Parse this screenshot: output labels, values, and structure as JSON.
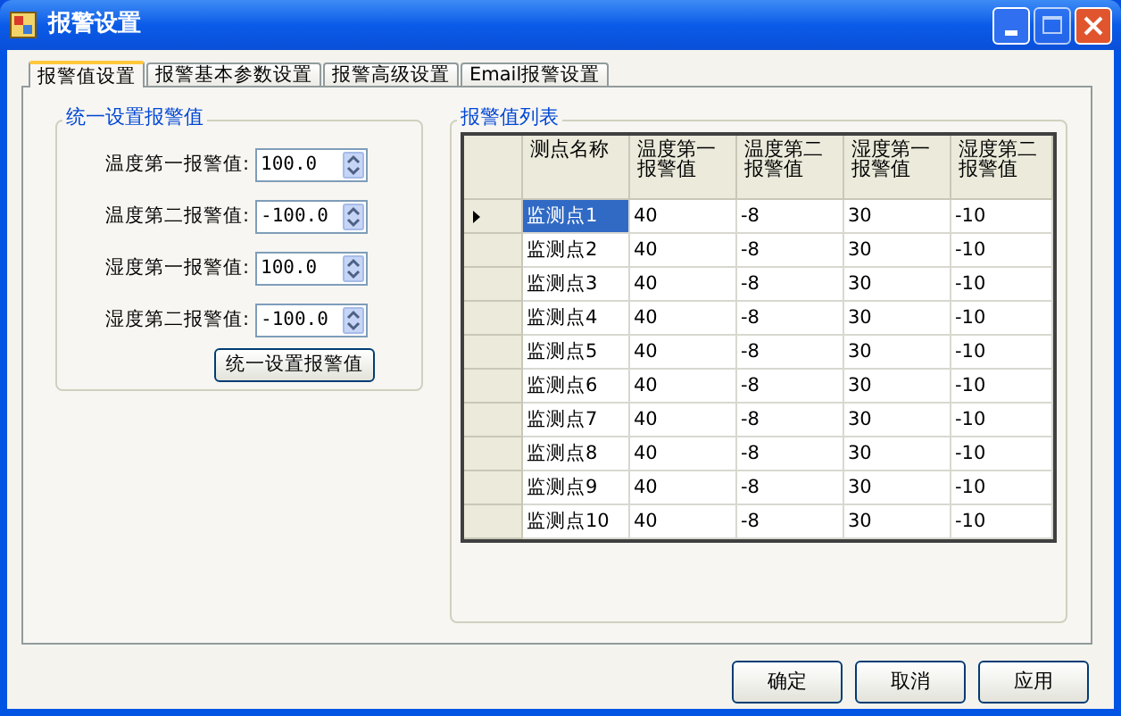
{
  "window": {
    "title": "报警设置"
  },
  "tabs": [
    {
      "label": "报警值设置",
      "selected": true
    },
    {
      "label": "报警基本参数设置",
      "selected": false
    },
    {
      "label": "报警高级设置",
      "selected": false
    },
    {
      "label": "Email报警设置",
      "selected": false
    }
  ],
  "uniform_group": {
    "title": "统一设置报警值",
    "fields": [
      {
        "label": "温度第一报警值:",
        "value": "100.0"
      },
      {
        "label": "温度第二报警值:",
        "value": "-100.0"
      },
      {
        "label": "湿度第一报警值:",
        "value": "100.0"
      },
      {
        "label": "湿度第二报警值:",
        "value": "-100.0"
      }
    ],
    "button": "统一设置报警值"
  },
  "list_group": {
    "title": "报警值列表",
    "columns": [
      "测点名称",
      "温度第一报警值",
      "温度第二报警值",
      "湿度第一报警值",
      "湿度第二报警值"
    ],
    "rows": [
      {
        "selected": true,
        "cells": [
          "监测点1",
          "40",
          "-8",
          "30",
          "-10"
        ]
      },
      {
        "selected": false,
        "cells": [
          "监测点2",
          "40",
          "-8",
          "30",
          "-10"
        ]
      },
      {
        "selected": false,
        "cells": [
          "监测点3",
          "40",
          "-8",
          "30",
          "-10"
        ]
      },
      {
        "selected": false,
        "cells": [
          "监测点4",
          "40",
          "-8",
          "30",
          "-10"
        ]
      },
      {
        "selected": false,
        "cells": [
          "监测点5",
          "40",
          "-8",
          "30",
          "-10"
        ]
      },
      {
        "selected": false,
        "cells": [
          "监测点6",
          "40",
          "-8",
          "30",
          "-10"
        ]
      },
      {
        "selected": false,
        "cells": [
          "监测点7",
          "40",
          "-8",
          "30",
          "-10"
        ]
      },
      {
        "selected": false,
        "cells": [
          "监测点8",
          "40",
          "-8",
          "30",
          "-10"
        ]
      },
      {
        "selected": false,
        "cells": [
          "监测点9",
          "40",
          "-8",
          "30",
          "-10"
        ]
      },
      {
        "selected": false,
        "cells": [
          "监测点10",
          "40",
          "-8",
          "30",
          "-10"
        ]
      }
    ]
  },
  "buttons": [
    "确定",
    "取消",
    "应用"
  ]
}
